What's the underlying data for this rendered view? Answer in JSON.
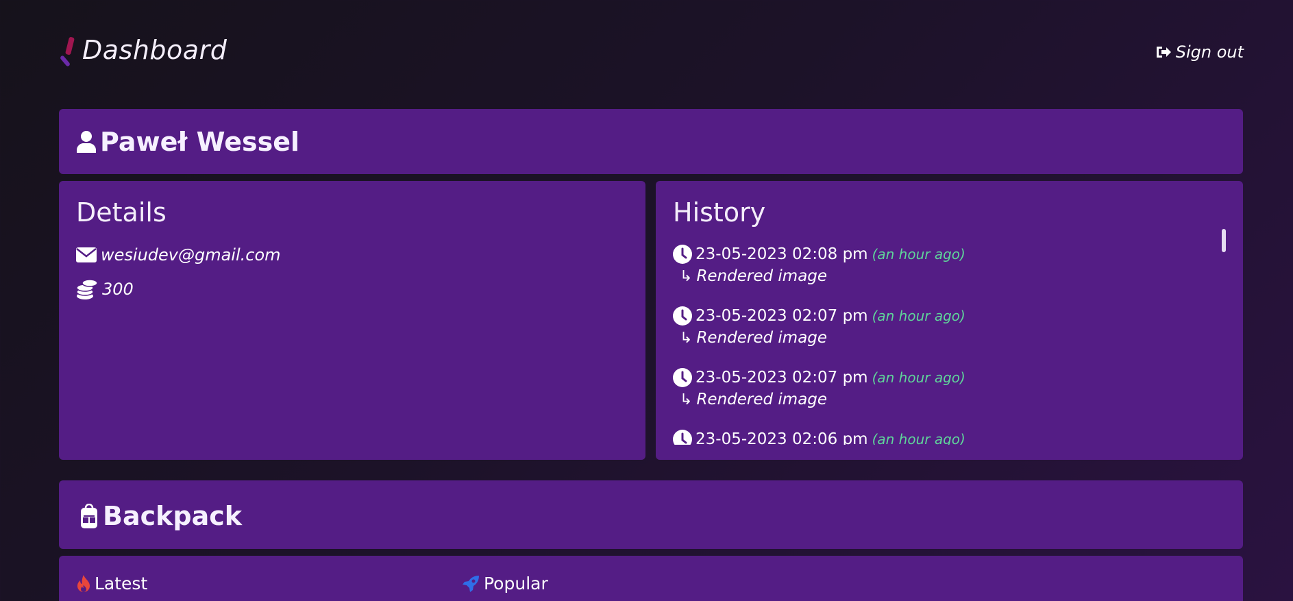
{
  "header": {
    "title": "Dashboard",
    "signout_label": "Sign out"
  },
  "user": {
    "name": "Paweł Wessel"
  },
  "details": {
    "heading": "Details",
    "email": "wesiudev@gmail.com",
    "coins": "300"
  },
  "history": {
    "heading": "History",
    "entries": [
      {
        "time": "23-05-2023 02:08 pm",
        "ago": "(an hour ago)",
        "action": "Rendered image"
      },
      {
        "time": "23-05-2023 02:07 pm",
        "ago": "(an hour ago)",
        "action": "Rendered image"
      },
      {
        "time": "23-05-2023 02:07 pm",
        "ago": "(an hour ago)",
        "action": "Rendered image"
      },
      {
        "time": "23-05-2023 02:06 pm",
        "ago": "(an hour ago)",
        "action": ""
      }
    ]
  },
  "backpack": {
    "title": "Backpack",
    "tabs": [
      {
        "label": "Latest",
        "icon": "fire-icon",
        "color": "#e8463c"
      },
      {
        "label": "Popular",
        "icon": "rocket-icon",
        "color": "#2f6ee8"
      }
    ]
  },
  "colors": {
    "card": "#541d85",
    "accent_green": "#5fd49a"
  }
}
